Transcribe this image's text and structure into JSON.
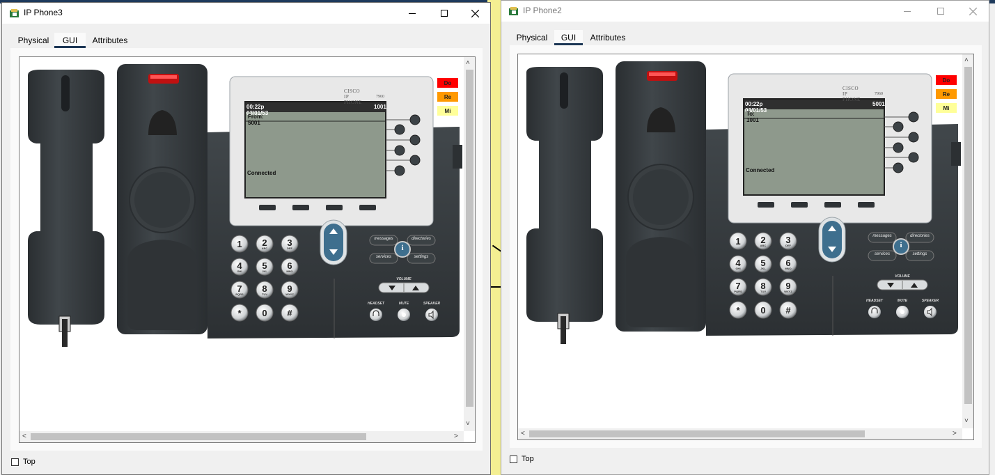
{
  "windows": [
    {
      "title": "IP Phone3",
      "tabs": [
        "Physical",
        "GUI",
        "Attributes"
      ],
      "selected_tab": "GUI",
      "phone": {
        "brand": "CISCO IP PHONE",
        "model": "7960",
        "lcd_time": "00:22p 03/01/53",
        "lcd_ext": "1001",
        "lcd_line": "From: 5001",
        "lcd_status": "Connected",
        "side_buttons": [
          "Do",
          "Re",
          "Mi"
        ]
      },
      "top_label": "Top"
    },
    {
      "title": "IP Phone2",
      "tabs": [
        "Physical",
        "GUI",
        "Attributes"
      ],
      "selected_tab": "GUI",
      "phone": {
        "brand": "CISCO IP PHONE",
        "model": "7960",
        "lcd_time": "00:22p 03/01/53",
        "lcd_ext": "5001",
        "lcd_line": "To: 1001",
        "lcd_status": "Connected",
        "side_buttons": [
          "Do",
          "Re",
          "Mi"
        ]
      },
      "top_label": "Top"
    }
  ],
  "keypad": [
    {
      "digit": "1",
      "letters": ""
    },
    {
      "digit": "2",
      "letters": "ABC"
    },
    {
      "digit": "3",
      "letters": "DEF"
    },
    {
      "digit": "4",
      "letters": "GHI"
    },
    {
      "digit": "5",
      "letters": "JKL"
    },
    {
      "digit": "6",
      "letters": "MNO"
    },
    {
      "digit": "7",
      "letters": "PQRS"
    },
    {
      "digit": "8",
      "letters": "TUV"
    },
    {
      "digit": "9",
      "letters": "WXYZ"
    },
    {
      "digit": "*",
      "letters": ""
    },
    {
      "digit": "0",
      "letters": ""
    },
    {
      "digit": "#",
      "letters": ""
    }
  ],
  "function_keys": {
    "messages": "messages",
    "directories": "directories",
    "services": "services",
    "settings": "settings",
    "info": "i"
  },
  "volume_label": "VOLUME",
  "audio_keys": {
    "headset": "HEADSET",
    "mute": "MUTE",
    "speaker": "SPEAKER"
  },
  "colors": {
    "side_do": "#ff0000",
    "side_re": "#ff9900",
    "side_mi": "#ffff99",
    "lcd": "#8e998c",
    "phone_body": "#3b4043",
    "tab_underline": "#1c3655"
  }
}
